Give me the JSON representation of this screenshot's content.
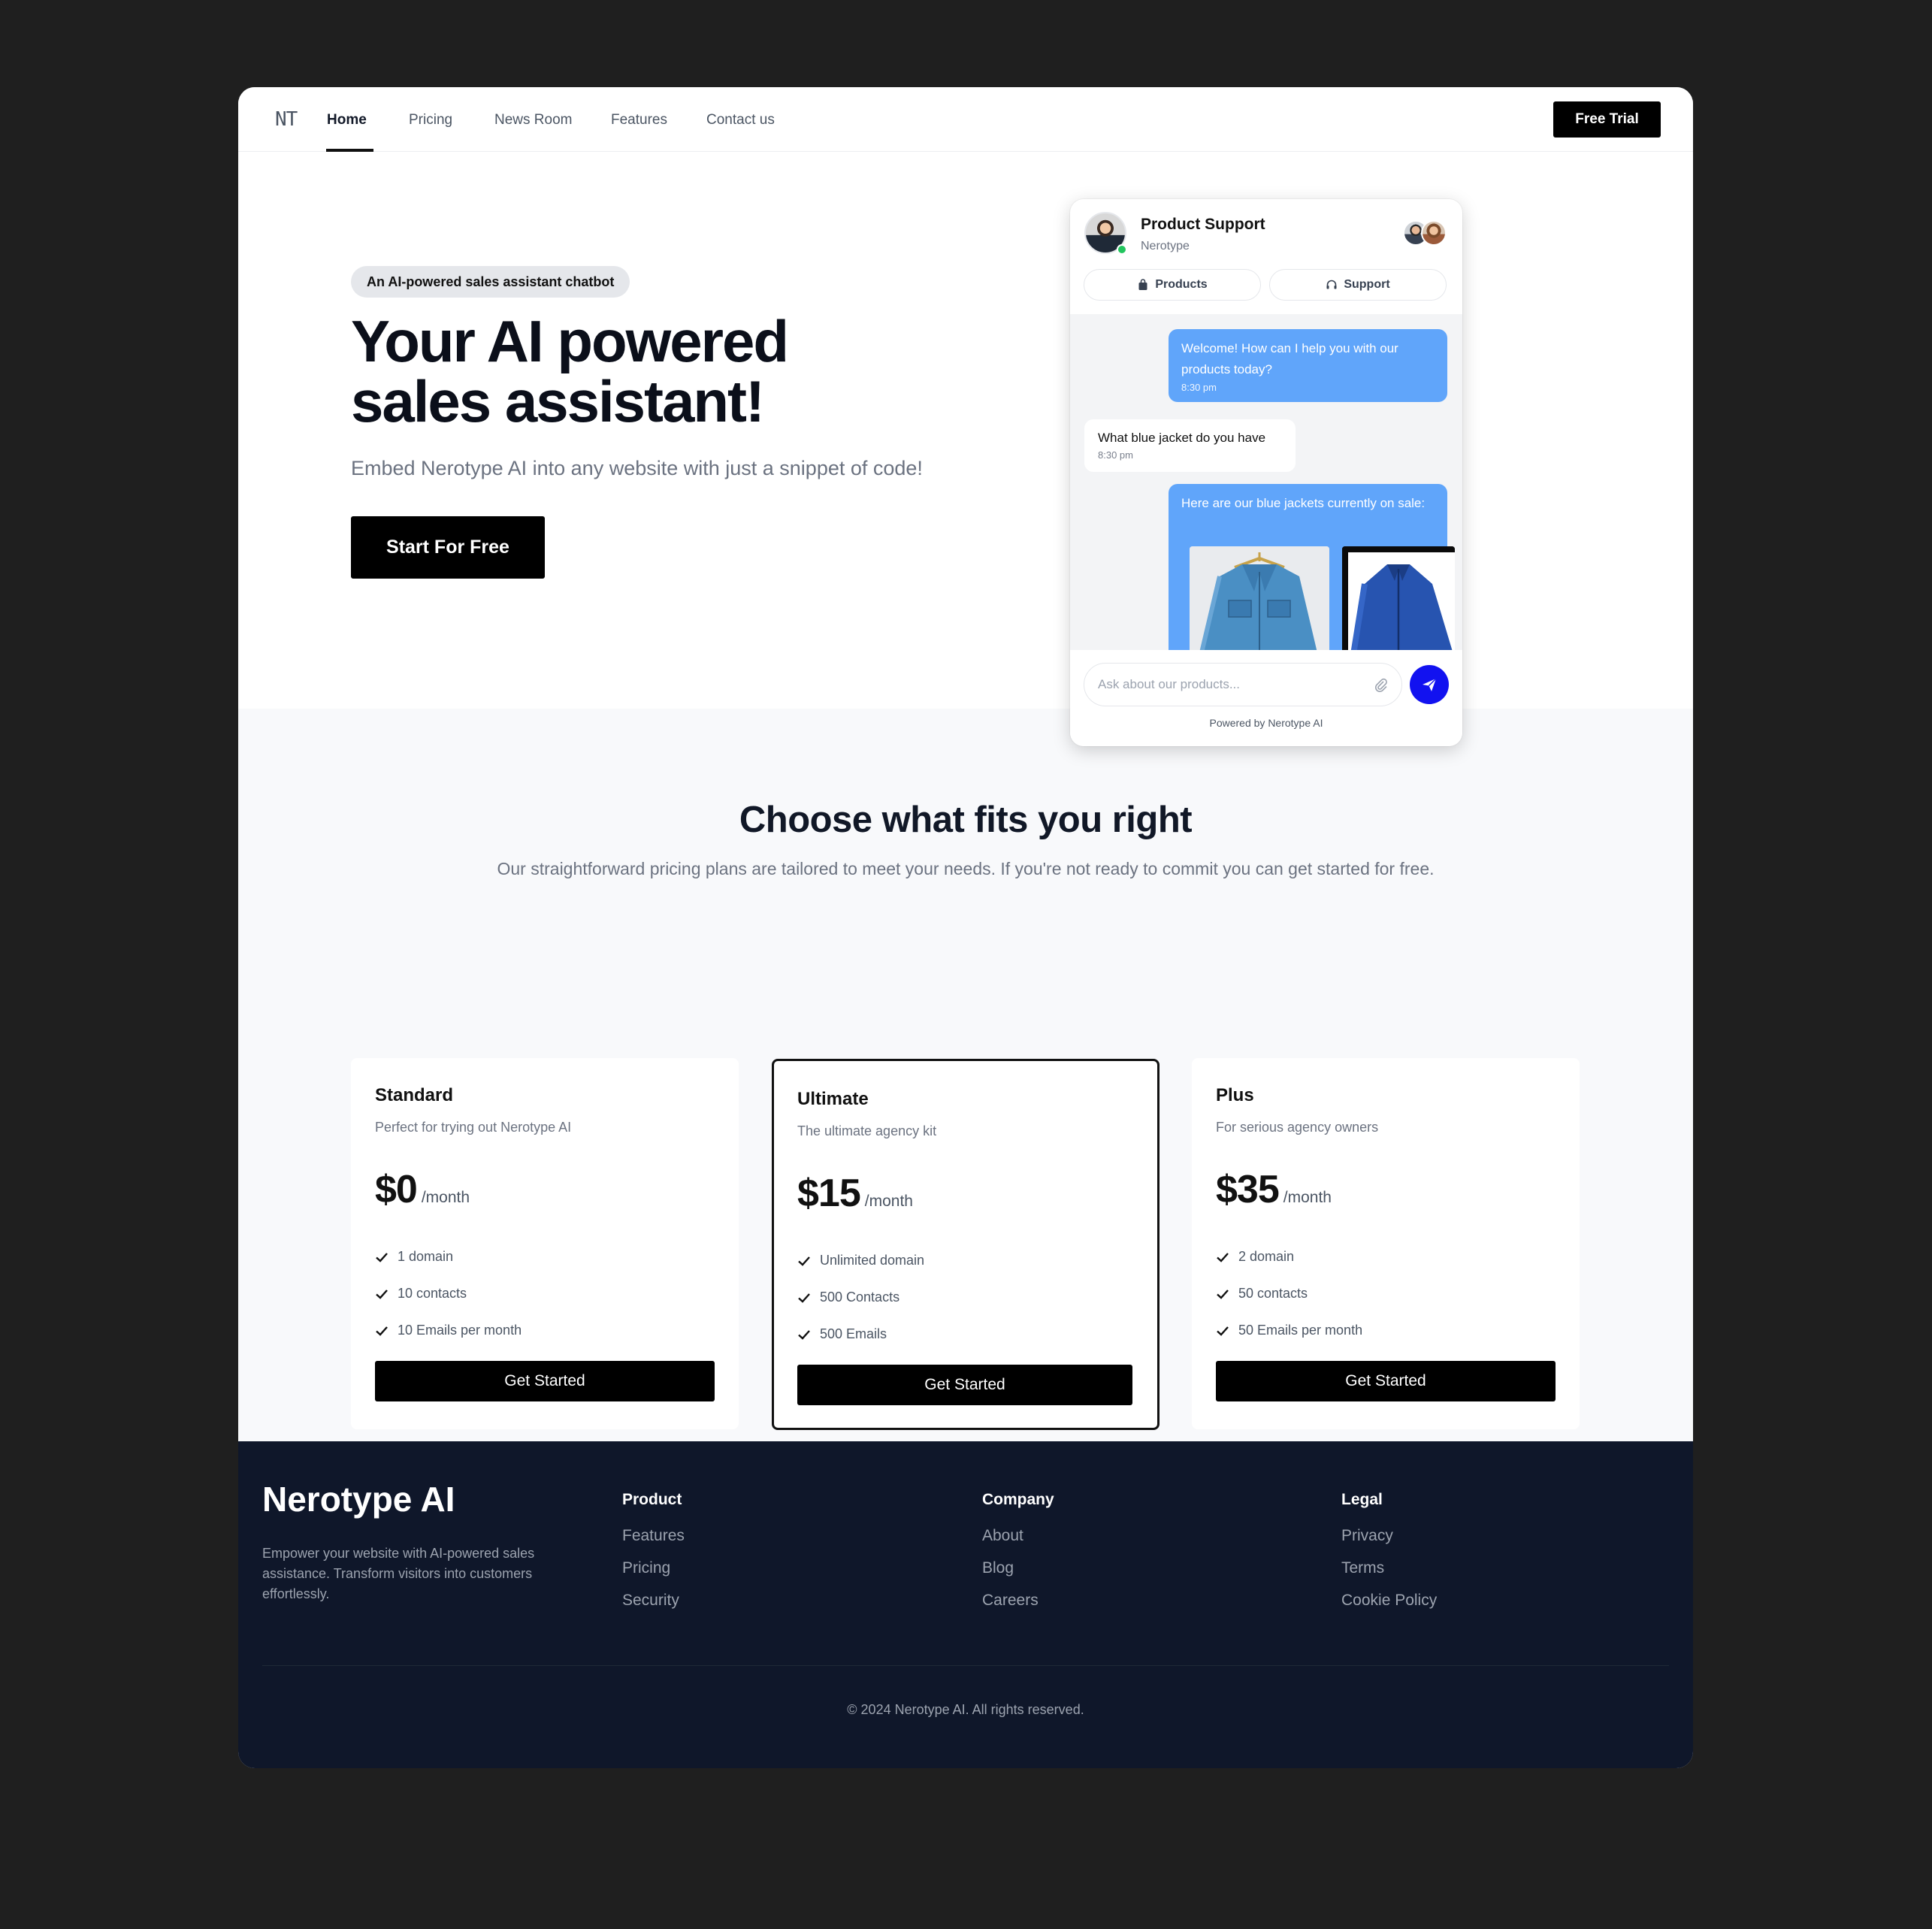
{
  "nav": {
    "logo": "NT",
    "links": [
      "Home",
      "Pricing",
      "News Room",
      "Features",
      "Contact us"
    ],
    "active": "Home",
    "cta": "Free Trial"
  },
  "hero": {
    "badge": "An AI-powered sales assistant chatbot",
    "title_line1": "Your AI powered",
    "title_line2": "sales assistant!",
    "subtitle": "Embed Nerotype AI into any website with just a snippet of code!",
    "cta": "Start For Free"
  },
  "chat": {
    "title": "Product Support",
    "subtitle": "Nerotype",
    "tabs": [
      {
        "label": "Products",
        "icon": "bag-icon"
      },
      {
        "label": "Support",
        "icon": "headset-icon"
      }
    ],
    "messages": [
      {
        "from": "bot",
        "text": "Welcome! How can I help you with our products today?",
        "time": "8:30 pm"
      },
      {
        "from": "user",
        "text": "What blue jacket do you have",
        "time": "8:30 pm"
      },
      {
        "from": "bot",
        "text": "Here are our blue jackets currently on sale:"
      }
    ],
    "input_placeholder": "Ask about our products...",
    "powered_by": "Powered by Nerotype AI",
    "accent_color": "#60a5fa",
    "send_color": "#1212f0"
  },
  "pricing": {
    "title": "Choose what fits you right",
    "subtitle": "Our straightforward pricing plans are tailored to meet your needs. If you're not ready to commit you can get started for free.",
    "plans": [
      {
        "name": "Standard",
        "desc": "Perfect for trying out Nerotype AI",
        "price": "$0",
        "period": "/month",
        "features": [
          "1 domain",
          "10 contacts",
          "10 Emails per month"
        ],
        "cta": "Get Started"
      },
      {
        "name": "Ultimate",
        "desc": "The ultimate agency kit",
        "price": "$15",
        "period": "/month",
        "features": [
          "Unlimited domain",
          "500 Contacts",
          "500 Emails"
        ],
        "cta": "Get Started",
        "featured": true
      },
      {
        "name": "Plus",
        "desc": "For serious agency owners",
        "price": "$35",
        "period": "/month",
        "features": [
          "2 domain",
          "50 contacts",
          "50 Emails per month"
        ],
        "cta": "Get Started"
      }
    ]
  },
  "footer": {
    "brand": "Nerotype AI",
    "tagline": "Empower your website with AI-powered sales assistance. Transform visitors into customers effortlessly.",
    "columns": [
      {
        "title": "Product",
        "links": [
          "Features",
          "Pricing",
          "Security"
        ]
      },
      {
        "title": "Company",
        "links": [
          "About",
          "Blog",
          "Careers"
        ]
      },
      {
        "title": "Legal",
        "links": [
          "Privacy",
          "Terms",
          "Cookie Policy"
        ]
      }
    ],
    "copyright": "© 2024 Nerotype  AI. All rights reserved."
  }
}
